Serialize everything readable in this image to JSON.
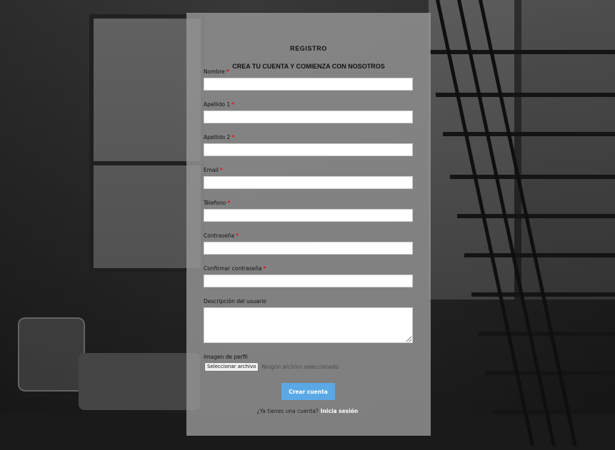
{
  "form": {
    "title": "REGISTRO",
    "subtitle": "CREA TU CUENTA Y COMIENZA CON NOSOTROS",
    "fields": [
      {
        "label": "Nombre",
        "required": "*",
        "value": ""
      },
      {
        "label": "Apellido 1",
        "required": "*",
        "value": ""
      },
      {
        "label": "Apellido 2",
        "required": "*",
        "value": ""
      },
      {
        "label": "Email",
        "required": "*",
        "value": ""
      },
      {
        "label": "Télefono",
        "required": "*",
        "value": ""
      },
      {
        "label": "Contraseña",
        "required": "*",
        "value": ""
      },
      {
        "label": "Confirmar contraseña",
        "required": "*",
        "value": ""
      }
    ],
    "description_label": "Descripción del usuario",
    "image_label": "Imagen de perfil",
    "file_button": "Seleccionar archivo",
    "file_status": "Ningún archivo seleccionado",
    "submit_label": "Crear cuenta",
    "login_prompt": "¿Ya tienes una cuenta?",
    "login_link": "Inicia sesión"
  },
  "colors": {
    "accent": "#5aa9e6",
    "required": "#dd1111",
    "panel": "#969696"
  }
}
